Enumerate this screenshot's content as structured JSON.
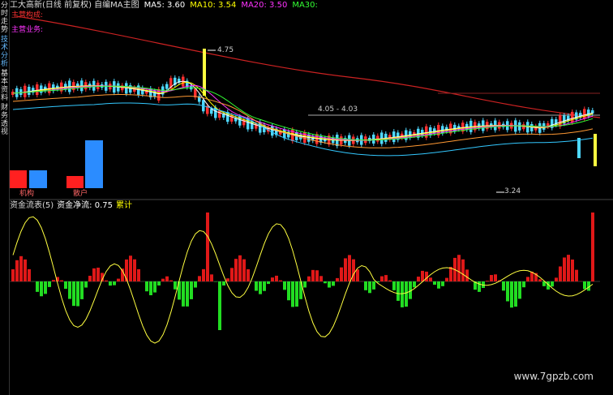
{
  "sidebar": {
    "tabs": [
      "分时走势",
      "技术分析",
      "基本资料",
      "财务透视"
    ]
  },
  "topbar": {
    "title": "工大高新(日线 前复权) 自编MA主图",
    "ma5": "MA5: 3.60",
    "ma10": "MA10: 3.54",
    "ma20": "MA20: 3.50",
    "ma30": "MA30:"
  },
  "main": {
    "line1": "主营构成:",
    "line2": "主营业务:",
    "high_label": "4.75",
    "low_label": "3.24",
    "mid_label": "4.05 - 4.03",
    "bar_labels": [
      "机构",
      "散户"
    ]
  },
  "indicator": {
    "name": "资金流表(5)",
    "net_flow": "资金净流: 0.75",
    "cumulative": "累计"
  },
  "watermark": "www.7gpzb.com",
  "colors": {
    "up": "#ff3030",
    "down": "#4fd8ff",
    "ma5": "#ffffff",
    "ma10": "#ffff00",
    "ma20": "#ff33ff",
    "ma30": "#33ff33"
  }
}
